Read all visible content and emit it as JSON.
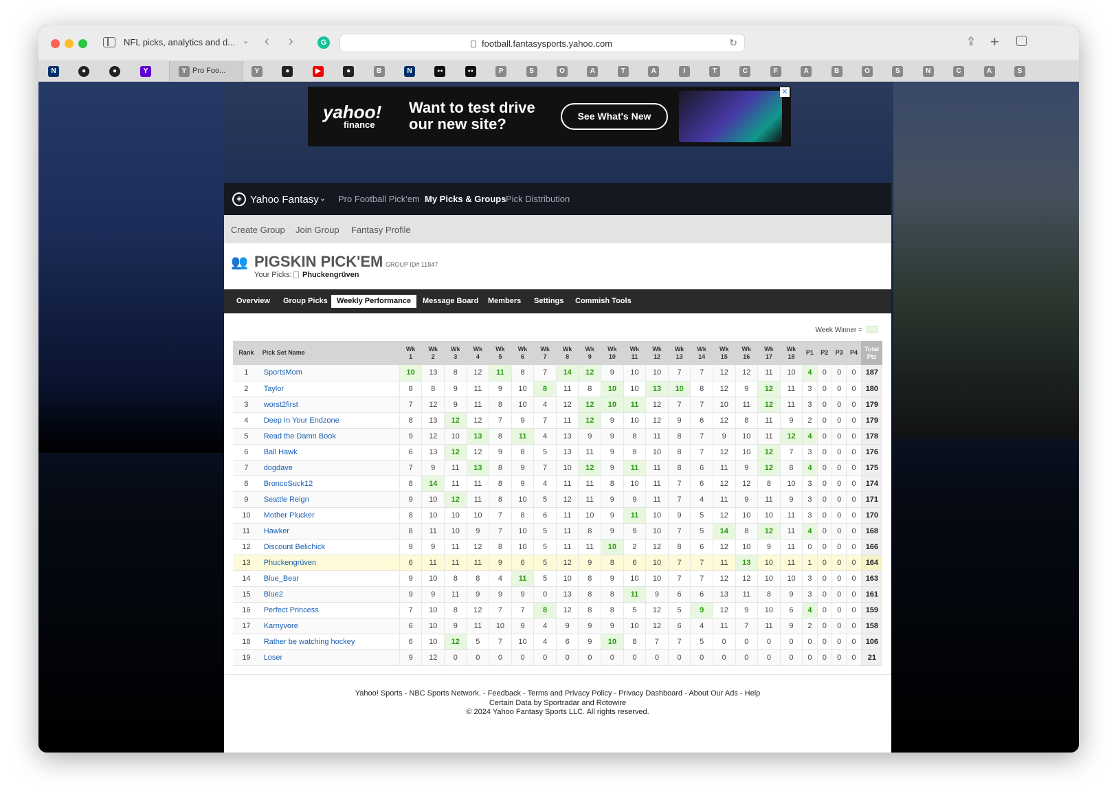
{
  "browser": {
    "tab_title": "NFL picks, analytics and d...",
    "url": "football.fantasysports.yahoo.com",
    "pinned_tab_label": "Pro Foo...",
    "tab_letters": [
      "Y",
      "B",
      "P",
      "S",
      "O",
      "A",
      "T",
      "A",
      "I",
      "T",
      "C",
      "F",
      "A",
      "B",
      "O",
      "S",
      "N",
      "C",
      "A",
      "S"
    ]
  },
  "ad": {
    "brand": "yahoo!",
    "brand_sub": "finance",
    "headline_1": "Want to test drive",
    "headline_2": "our new site?",
    "cta": "See What's New"
  },
  "nav": {
    "brand": "Yahoo Fantasy",
    "links": [
      "Pro Football Pick'em",
      "My Picks & Groups",
      "Pick Distribution"
    ]
  },
  "subnav": [
    "Create Group",
    "Join Group",
    "Fantasy Profile"
  ],
  "group": {
    "title": "PIGSKIN PICK'EM",
    "group_id": "GROUP ID# 11847",
    "your_picks_label": "Your Picks:",
    "your_picks_name": "Phuckengrüven"
  },
  "tabs": [
    "Overview",
    "Group Picks",
    "Weekly Performance",
    "Message Board",
    "Members",
    "Settings",
    "Commish Tools"
  ],
  "legend": "Week Winner =",
  "table": {
    "headers": [
      "Rank",
      "Pick Set Name",
      "Wk 1",
      "Wk 2",
      "Wk 3",
      "Wk 4",
      "Wk 5",
      "Wk 6",
      "Wk 7",
      "Wk 8",
      "Wk 9",
      "Wk 10",
      "Wk 11",
      "Wk 12",
      "Wk 13",
      "Wk 14",
      "Wk 15",
      "Wk 16",
      "Wk 17",
      "Wk 18",
      "P1",
      "P2",
      "P3",
      "P4",
      "Total Pts"
    ],
    "rows": [
      {
        "rank": "1",
        "name": "SportsMom",
        "vals": [
          "10",
          "13",
          "8",
          "12",
          "11",
          "8",
          "7",
          "14",
          "12",
          "9",
          "10",
          "10",
          "7",
          "7",
          "12",
          "12",
          "11",
          "10",
          "4",
          "0",
          "0",
          "0"
        ],
        "total": "187",
        "wins": [
          0,
          4,
          7,
          8,
          18
        ]
      },
      {
        "rank": "2",
        "name": "Taylor",
        "vals": [
          "8",
          "8",
          "9",
          "11",
          "9",
          "10",
          "8",
          "11",
          "8",
          "10",
          "10",
          "13",
          "10",
          "8",
          "12",
          "9",
          "12",
          "11",
          "3",
          "0",
          "0",
          "0"
        ],
        "total": "180",
        "wins": [
          6,
          9,
          11,
          12,
          16
        ]
      },
      {
        "rank": "3",
        "name": "worst2first",
        "vals": [
          "7",
          "12",
          "9",
          "11",
          "8",
          "10",
          "4",
          "12",
          "12",
          "10",
          "11",
          "12",
          "7",
          "7",
          "10",
          "11",
          "12",
          "11",
          "3",
          "0",
          "0",
          "0"
        ],
        "total": "179",
        "wins": [
          8,
          9,
          10,
          16
        ]
      },
      {
        "rank": "4",
        "name": "Deep In Your Endzone",
        "vals": [
          "8",
          "13",
          "12",
          "12",
          "7",
          "9",
          "7",
          "11",
          "12",
          "9",
          "10",
          "12",
          "9",
          "6",
          "12",
          "8",
          "11",
          "9",
          "2",
          "0",
          "0",
          "0"
        ],
        "total": "179",
        "wins": [
          2,
          8
        ]
      },
      {
        "rank": "5",
        "name": "Read the Damn Book",
        "vals": [
          "9",
          "12",
          "10",
          "13",
          "8",
          "11",
          "4",
          "13",
          "9",
          "9",
          "8",
          "11",
          "8",
          "7",
          "9",
          "10",
          "11",
          "12",
          "4",
          "0",
          "0",
          "0"
        ],
        "total": "178",
        "wins": [
          3,
          5,
          17,
          18
        ]
      },
      {
        "rank": "6",
        "name": "Ball Hawk",
        "vals": [
          "6",
          "13",
          "12",
          "12",
          "9",
          "8",
          "5",
          "13",
          "11",
          "9",
          "9",
          "10",
          "8",
          "7",
          "12",
          "10",
          "12",
          "7",
          "3",
          "0",
          "0",
          "0"
        ],
        "total": "176",
        "wins": [
          2,
          16
        ]
      },
      {
        "rank": "7",
        "name": "dogdave",
        "vals": [
          "7",
          "9",
          "11",
          "13",
          "8",
          "9",
          "7",
          "10",
          "12",
          "9",
          "11",
          "11",
          "8",
          "6",
          "11",
          "9",
          "12",
          "8",
          "4",
          "0",
          "0",
          "0"
        ],
        "total": "175",
        "wins": [
          3,
          8,
          10,
          16,
          18
        ]
      },
      {
        "rank": "8",
        "name": "BroncoSuck12",
        "vals": [
          "8",
          "14",
          "11",
          "11",
          "8",
          "9",
          "4",
          "11",
          "11",
          "8",
          "10",
          "11",
          "7",
          "6",
          "12",
          "12",
          "8",
          "10",
          "3",
          "0",
          "0",
          "0"
        ],
        "total": "174",
        "wins": [
          1
        ]
      },
      {
        "rank": "9",
        "name": "Seattle Reign",
        "vals": [
          "9",
          "10",
          "12",
          "11",
          "8",
          "10",
          "5",
          "12",
          "11",
          "9",
          "9",
          "11",
          "7",
          "4",
          "11",
          "9",
          "11",
          "9",
          "3",
          "0",
          "0",
          "0"
        ],
        "total": "171",
        "wins": [
          2
        ]
      },
      {
        "rank": "10",
        "name": "Mother Plucker",
        "vals": [
          "8",
          "10",
          "10",
          "10",
          "7",
          "8",
          "6",
          "11",
          "10",
          "9",
          "11",
          "10",
          "9",
          "5",
          "12",
          "10",
          "10",
          "11",
          "3",
          "0",
          "0",
          "0"
        ],
        "total": "170",
        "wins": [
          10
        ]
      },
      {
        "rank": "11",
        "name": "Hawker",
        "vals": [
          "8",
          "11",
          "10",
          "9",
          "7",
          "10",
          "5",
          "11",
          "8",
          "9",
          "9",
          "10",
          "7",
          "5",
          "14",
          "8",
          "12",
          "11",
          "4",
          "0",
          "0",
          "0"
        ],
        "total": "168",
        "wins": [
          14,
          16,
          18
        ]
      },
      {
        "rank": "12",
        "name": "Discount Belichick",
        "vals": [
          "9",
          "9",
          "11",
          "12",
          "8",
          "10",
          "5",
          "11",
          "11",
          "10",
          "2",
          "12",
          "8",
          "6",
          "12",
          "10",
          "9",
          "11",
          "0",
          "0",
          "0",
          "0"
        ],
        "total": "166",
        "wins": [
          9
        ]
      },
      {
        "rank": "13",
        "name": "Phuckengrüven",
        "vals": [
          "6",
          "11",
          "11",
          "11",
          "9",
          "6",
          "5",
          "12",
          "9",
          "8",
          "6",
          "10",
          "7",
          "7",
          "11",
          "13",
          "10",
          "11",
          "1",
          "0",
          "0",
          "0"
        ],
        "total": "164",
        "wins": [
          15
        ],
        "me": true
      },
      {
        "rank": "14",
        "name": "Blue_Bear",
        "vals": [
          "9",
          "10",
          "8",
          "8",
          "4",
          "11",
          "5",
          "10",
          "8",
          "9",
          "10",
          "10",
          "7",
          "7",
          "12",
          "12",
          "10",
          "10",
          "3",
          "0",
          "0",
          "0"
        ],
        "total": "163",
        "wins": [
          5
        ]
      },
      {
        "rank": "15",
        "name": "Blue2",
        "vals": [
          "9",
          "9",
          "11",
          "9",
          "9",
          "9",
          "0",
          "13",
          "8",
          "8",
          "11",
          "9",
          "6",
          "6",
          "13",
          "11",
          "8",
          "9",
          "3",
          "0",
          "0",
          "0"
        ],
        "total": "161",
        "wins": [
          10
        ]
      },
      {
        "rank": "16",
        "name": "Perfect Princess",
        "vals": [
          "7",
          "10",
          "8",
          "12",
          "7",
          "7",
          "8",
          "12",
          "8",
          "8",
          "5",
          "12",
          "5",
          "9",
          "12",
          "9",
          "10",
          "6",
          "4",
          "0",
          "0",
          "0"
        ],
        "total": "159",
        "wins": [
          6,
          13,
          18
        ]
      },
      {
        "rank": "17",
        "name": "Karnyvore",
        "vals": [
          "6",
          "10",
          "9",
          "11",
          "10",
          "9",
          "4",
          "9",
          "9",
          "9",
          "10",
          "12",
          "6",
          "4",
          "11",
          "7",
          "11",
          "9",
          "2",
          "0",
          "0",
          "0"
        ],
        "total": "158",
        "wins": []
      },
      {
        "rank": "18",
        "name": "Rather be watching hockey",
        "vals": [
          "6",
          "10",
          "12",
          "5",
          "7",
          "10",
          "4",
          "6",
          "9",
          "10",
          "8",
          "7",
          "7",
          "5",
          "0",
          "0",
          "0",
          "0",
          "0",
          "0",
          "0",
          "0"
        ],
        "total": "106",
        "wins": [
          2,
          9
        ]
      },
      {
        "rank": "19",
        "name": "Loser",
        "vals": [
          "9",
          "12",
          "0",
          "0",
          "0",
          "0",
          "0",
          "0",
          "0",
          "0",
          "0",
          "0",
          "0",
          "0",
          "0",
          "0",
          "0",
          "0",
          "0",
          "0",
          "0",
          "0"
        ],
        "total": "21",
        "wins": []
      }
    ]
  },
  "footer": {
    "line1": "Yahoo! Sports - NBC Sports Network. - Feedback - Terms and Privacy Policy - Privacy Dashboard  - About Our Ads - Help",
    "line2": "Certain Data by Sportradar and Rotowire",
    "line3": "© 2024 Yahoo Fantasy Sports LLC. All rights reserved."
  },
  "colors": {
    "win_green": "#2a9a10",
    "link_blue": "#1a5fb4",
    "highlight_row": "#fdfbd7"
  }
}
